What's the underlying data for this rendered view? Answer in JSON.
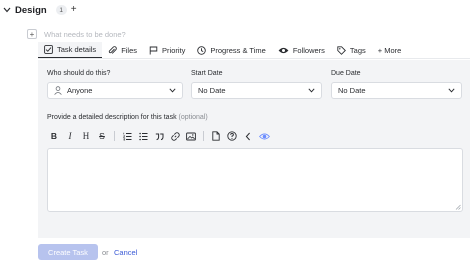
{
  "group": {
    "title": "Design",
    "count": "1",
    "add_label": "+"
  },
  "new_task": {
    "placeholder": "What needs to be done?"
  },
  "tabs": [
    {
      "label": "Task details",
      "icon": "checkbox-icon"
    },
    {
      "label": "Files",
      "icon": "paperclip-icon"
    },
    {
      "label": "Priority",
      "icon": "flag-icon"
    },
    {
      "label": "Progress & Time",
      "icon": "clock-icon"
    },
    {
      "label": "Followers",
      "icon": "eye-icon"
    },
    {
      "label": "Tags",
      "icon": "tag-icon"
    },
    {
      "label": "+ More",
      "icon": "plus-icon"
    }
  ],
  "form": {
    "assignee": {
      "label": "Who should do this?",
      "value": "Anyone"
    },
    "start_date": {
      "label": "Start Date",
      "value": "No Date"
    },
    "due_date": {
      "label": "Due Date",
      "value": "No Date"
    },
    "description": {
      "label": "Provide a detailed description for this task",
      "optional": "(optional)",
      "value": ""
    }
  },
  "toolbar": [
    "B",
    "I",
    "H",
    "S"
  ],
  "actions": {
    "create": "Create Task",
    "or": "or",
    "cancel": "Cancel"
  },
  "colors": {
    "accent": "#3b5bd6",
    "create_disabled": "#b7c3ee",
    "panel_bg": "#f3f4f6",
    "ai_icon": "#6b8cff"
  }
}
